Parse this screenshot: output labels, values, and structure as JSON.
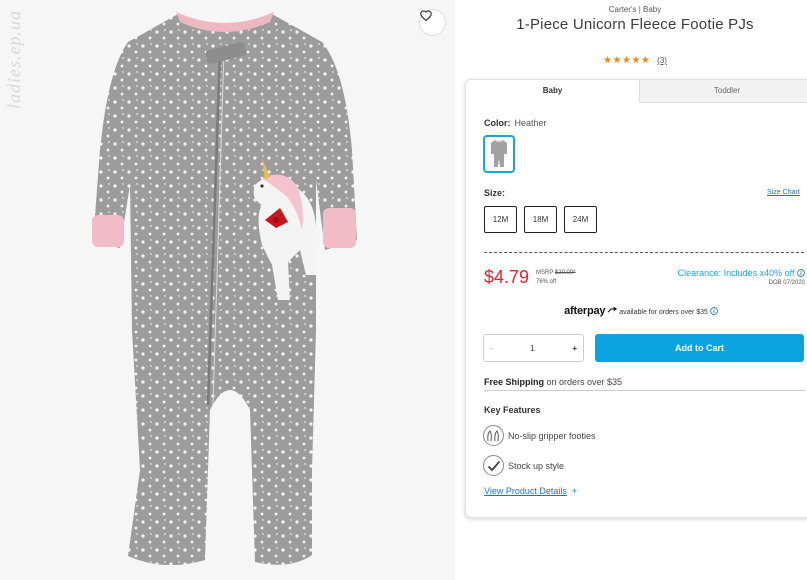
{
  "watermark": "ladies.ep.ua",
  "product": {
    "brand": "Carter's | Baby",
    "title": "1-Piece Unicorn Fleece Footie PJs",
    "rating_stars": "★★★★★",
    "review_count": "(3)"
  },
  "tabs": [
    {
      "label": "Baby",
      "active": true
    },
    {
      "label": "Toddler",
      "active": false
    }
  ],
  "color": {
    "label": "Color:",
    "value": "Heather"
  },
  "size": {
    "label": "Size:",
    "chart_link": "Size Chart",
    "options": [
      "12M",
      "18M",
      "24M"
    ]
  },
  "pricing": {
    "price": "$4.79",
    "msrp_label": "MSRP",
    "msrp_value": "$20.00*",
    "discount": "76% off",
    "clearance": "Clearance: Includes x40% off",
    "dob": "DOB 07/2020"
  },
  "afterpay": {
    "logo": "afterpay",
    "text": "available for orders over $35"
  },
  "cart": {
    "quantity": "1",
    "minus": "-",
    "plus": "+",
    "add_label": "Add to Cart"
  },
  "shipping": {
    "bold": "Free Shipping",
    "rest": " on orders over $35"
  },
  "features": {
    "title": "Key Features",
    "items": [
      {
        "label": "No-slip gripper footies",
        "icon": "gripper-footies-icon"
      },
      {
        "label": "Stock up style",
        "icon": "checkmark-icon"
      }
    ],
    "details_link": "View Product Details",
    "details_plus": "+"
  },
  "colors": {
    "accent": "#0aa3e0",
    "price": "#e0242b",
    "stars": "#e88b1a"
  }
}
